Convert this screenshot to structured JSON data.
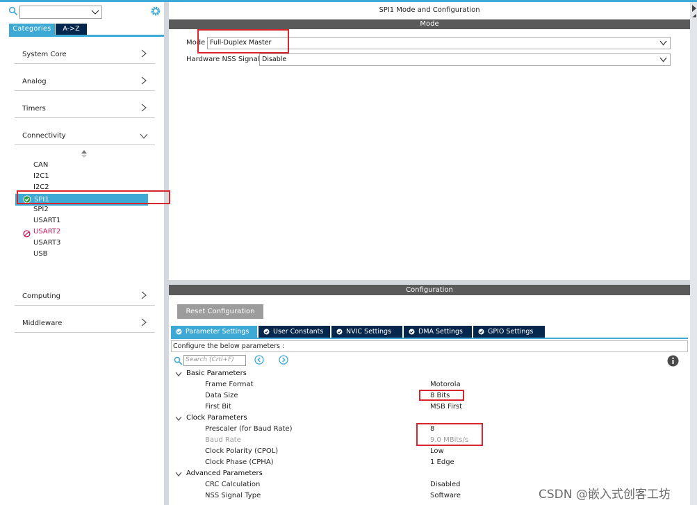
{
  "left_pane": {
    "search_value": "",
    "category_tabs": [
      "Categories",
      "A->Z"
    ],
    "categories": [
      {
        "label": "System Core",
        "expanded": false
      },
      {
        "label": "Analog",
        "expanded": false
      },
      {
        "label": "Timers",
        "expanded": false
      },
      {
        "label": "Connectivity",
        "expanded": true
      },
      {
        "label": "Computing",
        "expanded": false
      },
      {
        "label": "Middleware",
        "expanded": false
      }
    ],
    "peripherals": [
      "CAN",
      "I2C1",
      "I2C2",
      "SPI1",
      "SPI2",
      "USART1",
      "USART2",
      "USART3",
      "USB"
    ],
    "selected_peripheral": "SPI1",
    "error_peripheral": "USART2"
  },
  "mode_panel": {
    "title": "SPI1 Mode and Configuration",
    "band": "Mode",
    "fields": [
      {
        "label": "Mode",
        "value": "Full-Duplex Master"
      },
      {
        "label": "Hardware NSS Signal",
        "value": "Disable"
      }
    ]
  },
  "config_panel": {
    "band": "Configuration",
    "reset_label": "Reset Configuration",
    "tabs": [
      "Parameter Settings",
      "User Constants",
      "NVIC Settings",
      "DMA Settings",
      "GPIO Settings"
    ],
    "active_tab": "Parameter Settings",
    "hint": "Configure the below parameters :",
    "search_placeholder": "Search (Crtl+F)",
    "groups": [
      {
        "name": "Basic Parameters",
        "params": [
          {
            "name": "Frame Format",
            "value": "Motorola"
          },
          {
            "name": "Data Size",
            "value": "8 Bits"
          },
          {
            "name": "First Bit",
            "value": "MSB First"
          }
        ]
      },
      {
        "name": "Clock Parameters",
        "params": [
          {
            "name": "Prescaler (for Baud Rate)",
            "value": "8"
          },
          {
            "name": "Baud Rate",
            "value": "9.0 MBits/s",
            "disabled": true
          },
          {
            "name": "Clock Polarity (CPOL)",
            "value": "Low"
          },
          {
            "name": "Clock Phase (CPHA)",
            "value": "1 Edge"
          }
        ]
      },
      {
        "name": "Advanced Parameters",
        "params": [
          {
            "name": "CRC Calculation",
            "value": "Disabled"
          },
          {
            "name": "NSS Signal Type",
            "value": "Software"
          }
        ]
      }
    ]
  },
  "watermark": "CSDN @嵌入式创客工坊",
  "colors": {
    "accent": "#3fa9d6",
    "dark_tab": "#05264d",
    "band": "#5a5a5a",
    "highlight": "#d7262e",
    "error": "#c2185b"
  }
}
